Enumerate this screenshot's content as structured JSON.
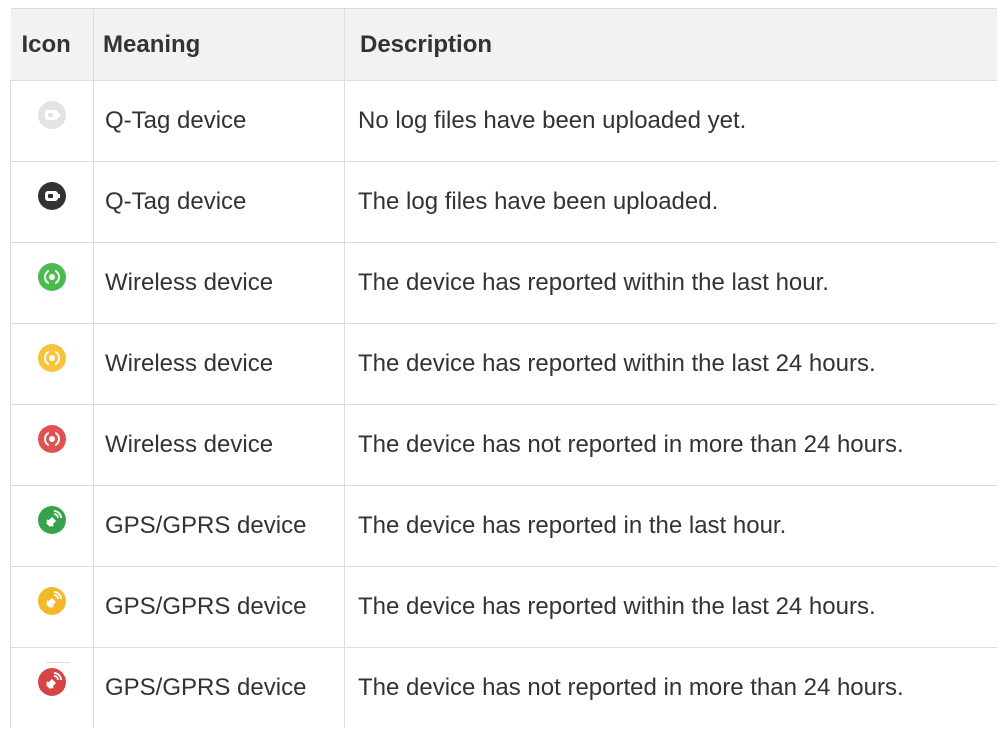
{
  "table": {
    "headers": {
      "icon": "Icon",
      "meaning": "Meaning",
      "description": "Description"
    },
    "rows": [
      {
        "icon": "qtag-empty-icon",
        "icon_color": "#e3e3e3",
        "meaning": "Q-Tag device",
        "description": "No log files have been uploaded yet."
      },
      {
        "icon": "qtag-uploaded-icon",
        "icon_color": "#333333",
        "meaning": "Q-Tag device",
        "description": "The log files have been uploaded."
      },
      {
        "icon": "wireless-green-icon",
        "icon_color": "#4cbb4f",
        "meaning": "Wireless device",
        "description": "The device has reported within the last hour."
      },
      {
        "icon": "wireless-yellow-icon",
        "icon_color": "#f7c33a",
        "meaning": "Wireless device",
        "description": "The device has reported within the last 24 hours."
      },
      {
        "icon": "wireless-red-icon",
        "icon_color": "#e05252",
        "meaning": "Wireless device",
        "description": "The device has not reported in more than 24 hours."
      },
      {
        "icon": "gps-green-icon",
        "icon_color": "#36a24a",
        "meaning": "GPS/GPRS device",
        "description": "The device has reported in the last hour."
      },
      {
        "icon": "gps-yellow-icon",
        "icon_color": "#f3b928",
        "meaning": "GPS/GPRS device",
        "description": "The device has reported within the last 24 hours."
      },
      {
        "icon": "gps-red-icon",
        "icon_color": "#d64545",
        "meaning": "GPS/GPRS device",
        "description": "The device has not reported in more than 24 hours."
      }
    ]
  }
}
